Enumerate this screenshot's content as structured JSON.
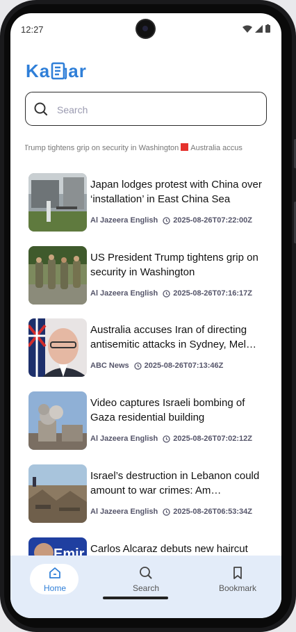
{
  "status_bar": {
    "time": "12:27"
  },
  "app": {
    "logo_left": "Ka",
    "logo_right": "ar",
    "accent": "#2f7fd8"
  },
  "search": {
    "placeholder": "Search"
  },
  "ticker": {
    "left_text": "esident Trump tightens grip on security in Washington",
    "right_text": "Australia accus"
  },
  "articles": [
    {
      "title": "Japan lodges protest with China over ‘installation’ in East China Sea",
      "source": "Al Jazeera English",
      "time": "2025-08-26T07:22:00Z"
    },
    {
      "title": "US President Trump tightens grip on security in Washington",
      "source": "Al Jazeera English",
      "time": "2025-08-26T07:16:17Z"
    },
    {
      "title": "Australia accuses Iran of directing antisemitic attacks in Sydney, Mel…",
      "source": "ABC News",
      "time": "2025-08-26T07:13:46Z"
    },
    {
      "title": "Video captures Israeli bombing of Gaza residential building",
      "source": "Al Jazeera English",
      "time": "2025-08-26T07:02:12Z"
    },
    {
      "title": "Israel’s destruction in Lebanon could amount to war crimes: Am…",
      "source": "Al Jazeera English",
      "time": "2025-08-26T06:53:34Z"
    },
    {
      "title": "Carlos Alcaraz debuts new haircut",
      "source": "",
      "time": ""
    }
  ],
  "nav": {
    "home": "Home",
    "search": "Search",
    "bookmark": "Bookmark"
  }
}
